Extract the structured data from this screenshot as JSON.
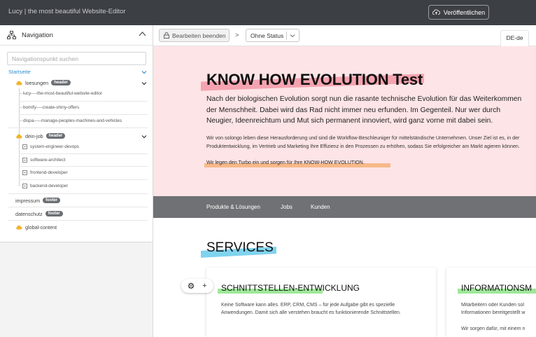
{
  "app": {
    "title": "Lucy | the most beautiful Website-Editor",
    "publish_label": "Veröffentlichen"
  },
  "sidebar": {
    "title": "Navigation",
    "search_placeholder": "Navigationspunkt suchen",
    "root": "Startseite",
    "groups": [
      {
        "label": "loesungen",
        "badge": "header",
        "items": [
          "lucy----the-most-beautiful-website-editor",
          "bomify----create-shiny-offers",
          "dispa-----manage-peoples-machines-and-vehicles"
        ]
      },
      {
        "label": "dein-job",
        "badge": "header",
        "items": [
          "system-engineer-devops",
          "software-architect",
          "frontend-developer",
          "backend-developer"
        ]
      }
    ],
    "impressum": {
      "label": "impressum",
      "badge": "footer"
    },
    "datenschutz": {
      "label": "datenschutz",
      "badge": "footer"
    },
    "global": {
      "label": "global-content"
    }
  },
  "toolbar": {
    "end_edit_label": "Bearbeiten beenden",
    "separator": ">",
    "status_label": "Ohne Status",
    "language": "DE-de"
  },
  "hero": {
    "title": "KNOW HOW EVOLUTION Test",
    "paragraph": "Nach der biologischen Evolution sorgt nun die rasante technische Evolution für das Weiterkommen der Menschheit. Dabei wird das Rad nicht immer neu erfunden. Im Gegenteil. Nur wer durch Neugier, Ideenreichtum und Mut sich permanent innoviert, wird ganz vorne mit dabei sein.",
    "small_text": "Wir von solongo leben diese Herausforderung und sind die Workflow-Beschleuniger für mittelständische Unternehmen. Unser Ziel ist es, in der Produktentwicklung, im Vertrieb und Marketing Ihre Effizienz in den Prozessen zu erhöhen, sodass Sie erfolgreicher am Markt agieren können.",
    "highlight": "Wir legen den Turbo ein und sorgen für Ihre KNOW-HOW EVOLUTION."
  },
  "site_nav": {
    "items": [
      "Produkte & Lösungen",
      "Jobs",
      "Kunden"
    ]
  },
  "services": {
    "title": "SERVICES",
    "card1": {
      "title": "SCHNITTSTELLEN-ENTWICKLUNG",
      "text": "Keine Software kann alles. ERP, CRM, CMS – für jede Aufgabe gibt es spezielle Anwendungen. Damit sich alle verstehen braucht es funktionierende Schnittstellen."
    },
    "card2": {
      "title": "INFORMATIONSM",
      "text1": "Mitarbeitern oder Kunden sol",
      "text2": "Informationen bereitgestellt w",
      "text3": "Wir sorgen dafür, mit einem n"
    }
  },
  "editor_tools": {
    "add_symbol": "+"
  }
}
